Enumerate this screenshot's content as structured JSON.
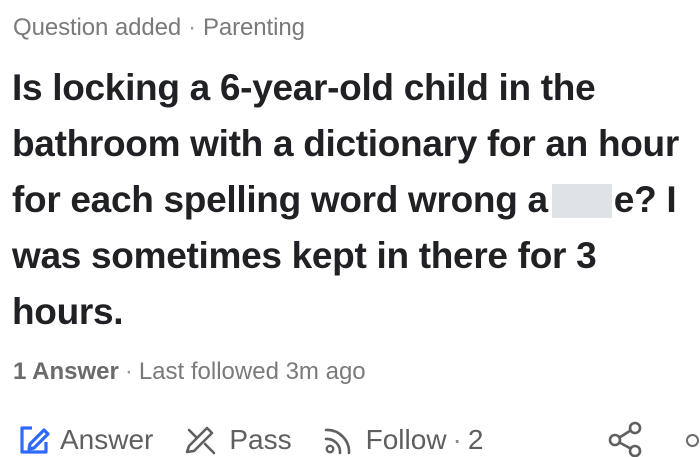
{
  "header": {
    "status": "Question added",
    "separator": "·",
    "topic": "Parenting"
  },
  "question": {
    "line1": "Is locking a 6-year-old child in the",
    "line2": "bathroom with a dictionary for an hour",
    "line3_before_redaction": "for each spelling word wrong a",
    "line3_after_redaction": "e? I",
    "line4": "was sometimes kept in there for 3",
    "line5": "hours."
  },
  "footer_meta": {
    "answers": "1 Answer",
    "separator": "·",
    "last_followed": "Last followed 3m ago"
  },
  "actions": {
    "answer_label": "Answer",
    "pass_label": "Pass",
    "follow_label": "Follow",
    "follow_separator": "·",
    "follow_count": "2"
  },
  "icons": {
    "answer": "pencil-square-icon",
    "pass": "pencil-cross-icon",
    "follow": "rss-icon",
    "share": "share-icon",
    "more": "more-icon"
  },
  "colors": {
    "answer_icon": "#2e69ff",
    "text_primary": "#202124",
    "text_secondary": "#7a7a7a",
    "redaction": "#dfe2e6"
  }
}
